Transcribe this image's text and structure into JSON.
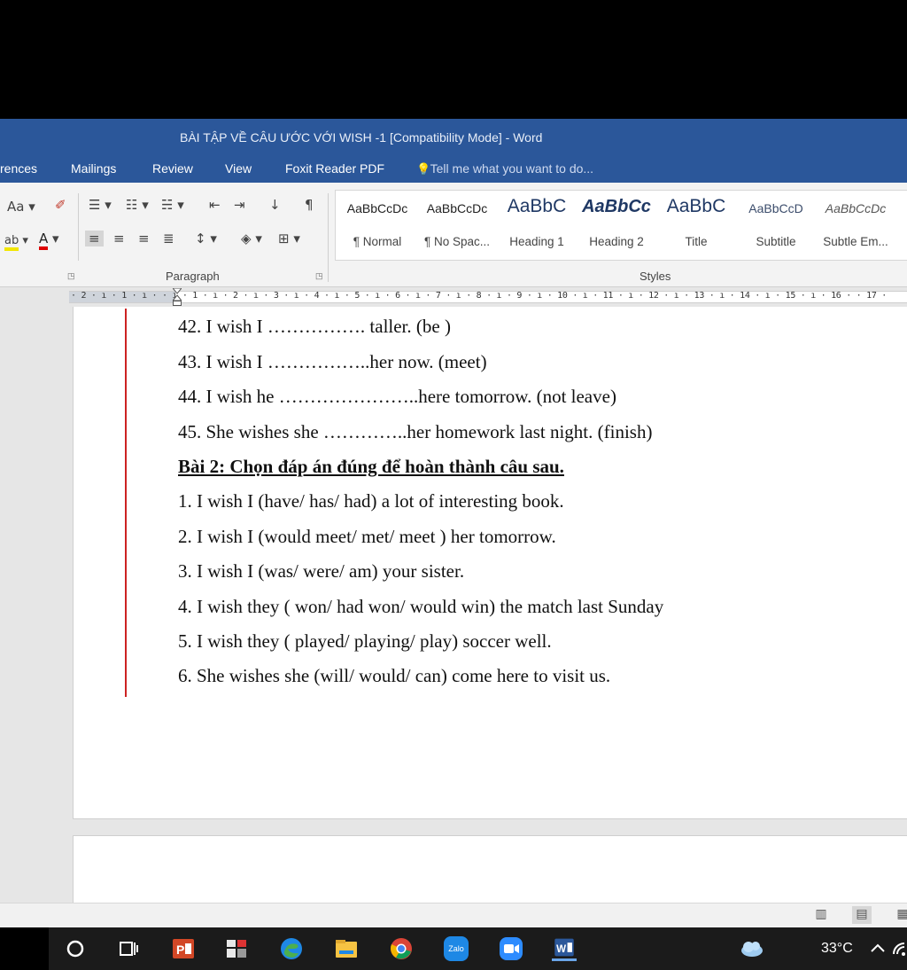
{
  "window": {
    "title": "BÀI TẬP VỀ CÂU ƯỚC VỚI WISH  -1 [Compatibility Mode] - Word"
  },
  "menu": {
    "tabs": [
      "rences",
      "Mailings",
      "Review",
      "View",
      "Foxit Reader PDF"
    ],
    "tell_me": "Tell me what you want to do..."
  },
  "ribbon": {
    "font_case_label": "Aa",
    "paragraph_group_label": "Paragraph",
    "styles_group_label": "Styles",
    "styles": [
      {
        "sample": "AaBbCcDc",
        "name": "¶ Normal"
      },
      {
        "sample": "AaBbCcDc",
        "name": "¶ No Spac..."
      },
      {
        "sample": "AaBbC",
        "name": "Heading 1"
      },
      {
        "sample": "AaBbCc",
        "name": "Heading 2"
      },
      {
        "sample": "AaBbC",
        "name": "Title"
      },
      {
        "sample": "AaBbCcD",
        "name": "Subtitle"
      },
      {
        "sample": "AaBbCcDc",
        "name": "Subtle Em..."
      }
    ]
  },
  "ruler": {
    "scale": "· 2 · ı · 1 · ı ·   · ı · 1 · ı · 2 · ı · 3 · ı · 4 · ı · 5 · ı · 6 · ı · 7 · ı · 8 · ı · 9 · ı · 10 · ı · 11 · ı · 12 · ı · 13 · ı · 14 · ı · 15 · ı · 16 ·   · 17 ·"
  },
  "document": {
    "lines": [
      "42. I wish  I ……………. taller. (be )",
      "43. I wish I ……………..her now. (meet)",
      "44. I wish he …………………..here tomorrow. (not leave)",
      "45. She wishes she …………..her homework last night. (finish)",
      "Bài 2: Chọn đáp án đúng để hoàn thành câu sau.",
      "1. I wish  I (have/ has/ had) a lot of interesting book.",
      "2. I wish  I (would meet/ met/ meet ) her tomorrow.",
      "3. I wish  I (was/ were/ am) your sister.",
      "4. I wish  they ( won/ had won/ would win) the match last Sunday",
      "5. I wish  they ( played/ playing/ play) soccer well.",
      "6. She wishes she (will/ would/ can) come here to visit us."
    ]
  },
  "taskbar": {
    "temperature": "33°C",
    "zalo_label": "Zalo"
  },
  "colors": {
    "word_blue": "#2b579a",
    "margin_line": "#cc2222"
  }
}
